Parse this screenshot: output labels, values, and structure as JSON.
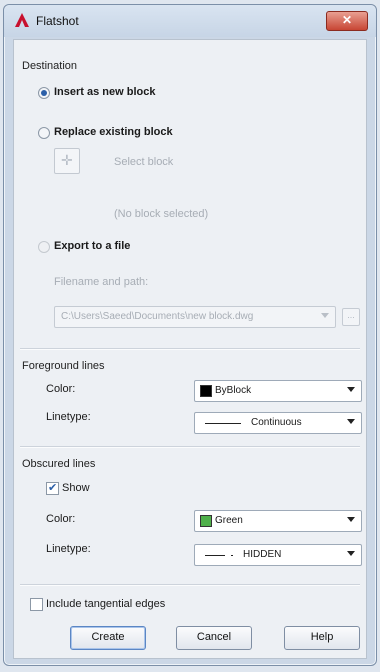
{
  "window": {
    "title": "Flatshot",
    "close_glyph": "✕"
  },
  "destination": {
    "section_label": "Destination",
    "insert_label": "Insert as new block",
    "replace_label": "Replace existing block",
    "select_block_label": "Select block",
    "no_block_label": "(No block selected)",
    "export_label": "Export to a file",
    "filename_label": "Filename and path:",
    "path_value": "C:\\Users\\Saeed\\Documents\\new block.dwg",
    "browse_label": "..."
  },
  "foreground": {
    "section_label": "Foreground lines",
    "color_label": "Color:",
    "color_value": "ByBlock",
    "color_swatch": "#000000",
    "linetype_label": "Linetype:",
    "linetype_value": "Continuous"
  },
  "obscured": {
    "section_label": "Obscured lines",
    "show_label": "Show",
    "show_checked": true,
    "color_label": "Color:",
    "color_value": "Green",
    "color_swatch": "#4fb04a",
    "linetype_label": "Linetype:",
    "linetype_value": "HIDDEN"
  },
  "options": {
    "tangential_label": "Include tangential edges",
    "tangential_checked": false
  },
  "buttons": {
    "create": "Create",
    "cancel": "Cancel",
    "help": "Help"
  },
  "icons": {
    "app": "autocad-a-icon",
    "pick": "crosshair-pick-icon"
  }
}
